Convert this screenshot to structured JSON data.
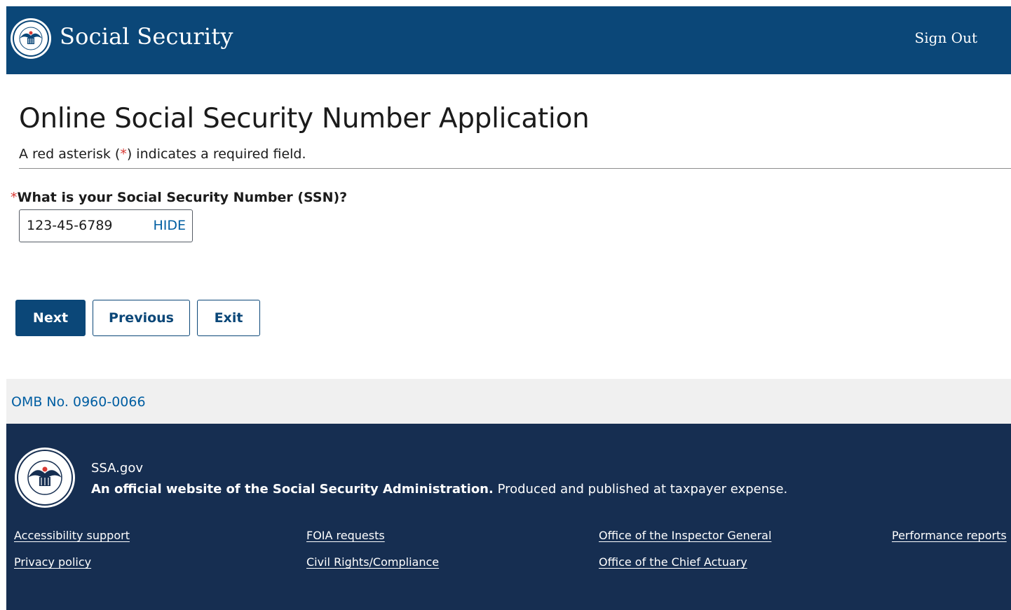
{
  "header": {
    "title": "Social Security",
    "sign_out": "Sign Out",
    "seal_text": "SOCIAL SECURITY ADMINISTRATION USA"
  },
  "main": {
    "title": "Online Social Security Number Application",
    "required_note_before": "A red asterisk (",
    "required_note_asterisk": "*",
    "required_note_after": ") indicates a required field.",
    "ssn_field": {
      "asterisk": "*",
      "label": "What is your Social Security Number (SSN)?",
      "value": "123-45-6789",
      "toggle_label": "HIDE"
    }
  },
  "buttons": {
    "next": "Next",
    "previous": "Previous",
    "exit": "Exit"
  },
  "omb": {
    "label": "OMB No. 0960-0066"
  },
  "footer": {
    "site": "SSA.gov",
    "official_bold": "An official website of the Social Security Administration.",
    "official_rest": " Produced and published at taxpayer expense.",
    "links": [
      "Accessibility support",
      "Privacy policy",
      "FOIA requests",
      "Civil Rights/Compliance",
      "Office of the Inspector General",
      "Office of the Chief Actuary",
      "Performance reports"
    ]
  },
  "colors": {
    "header_bg": "#0b4778",
    "footer_bg": "#162e51",
    "omb_bg": "#f0f0f0",
    "link": "#005ea2",
    "required": "#d83933"
  }
}
